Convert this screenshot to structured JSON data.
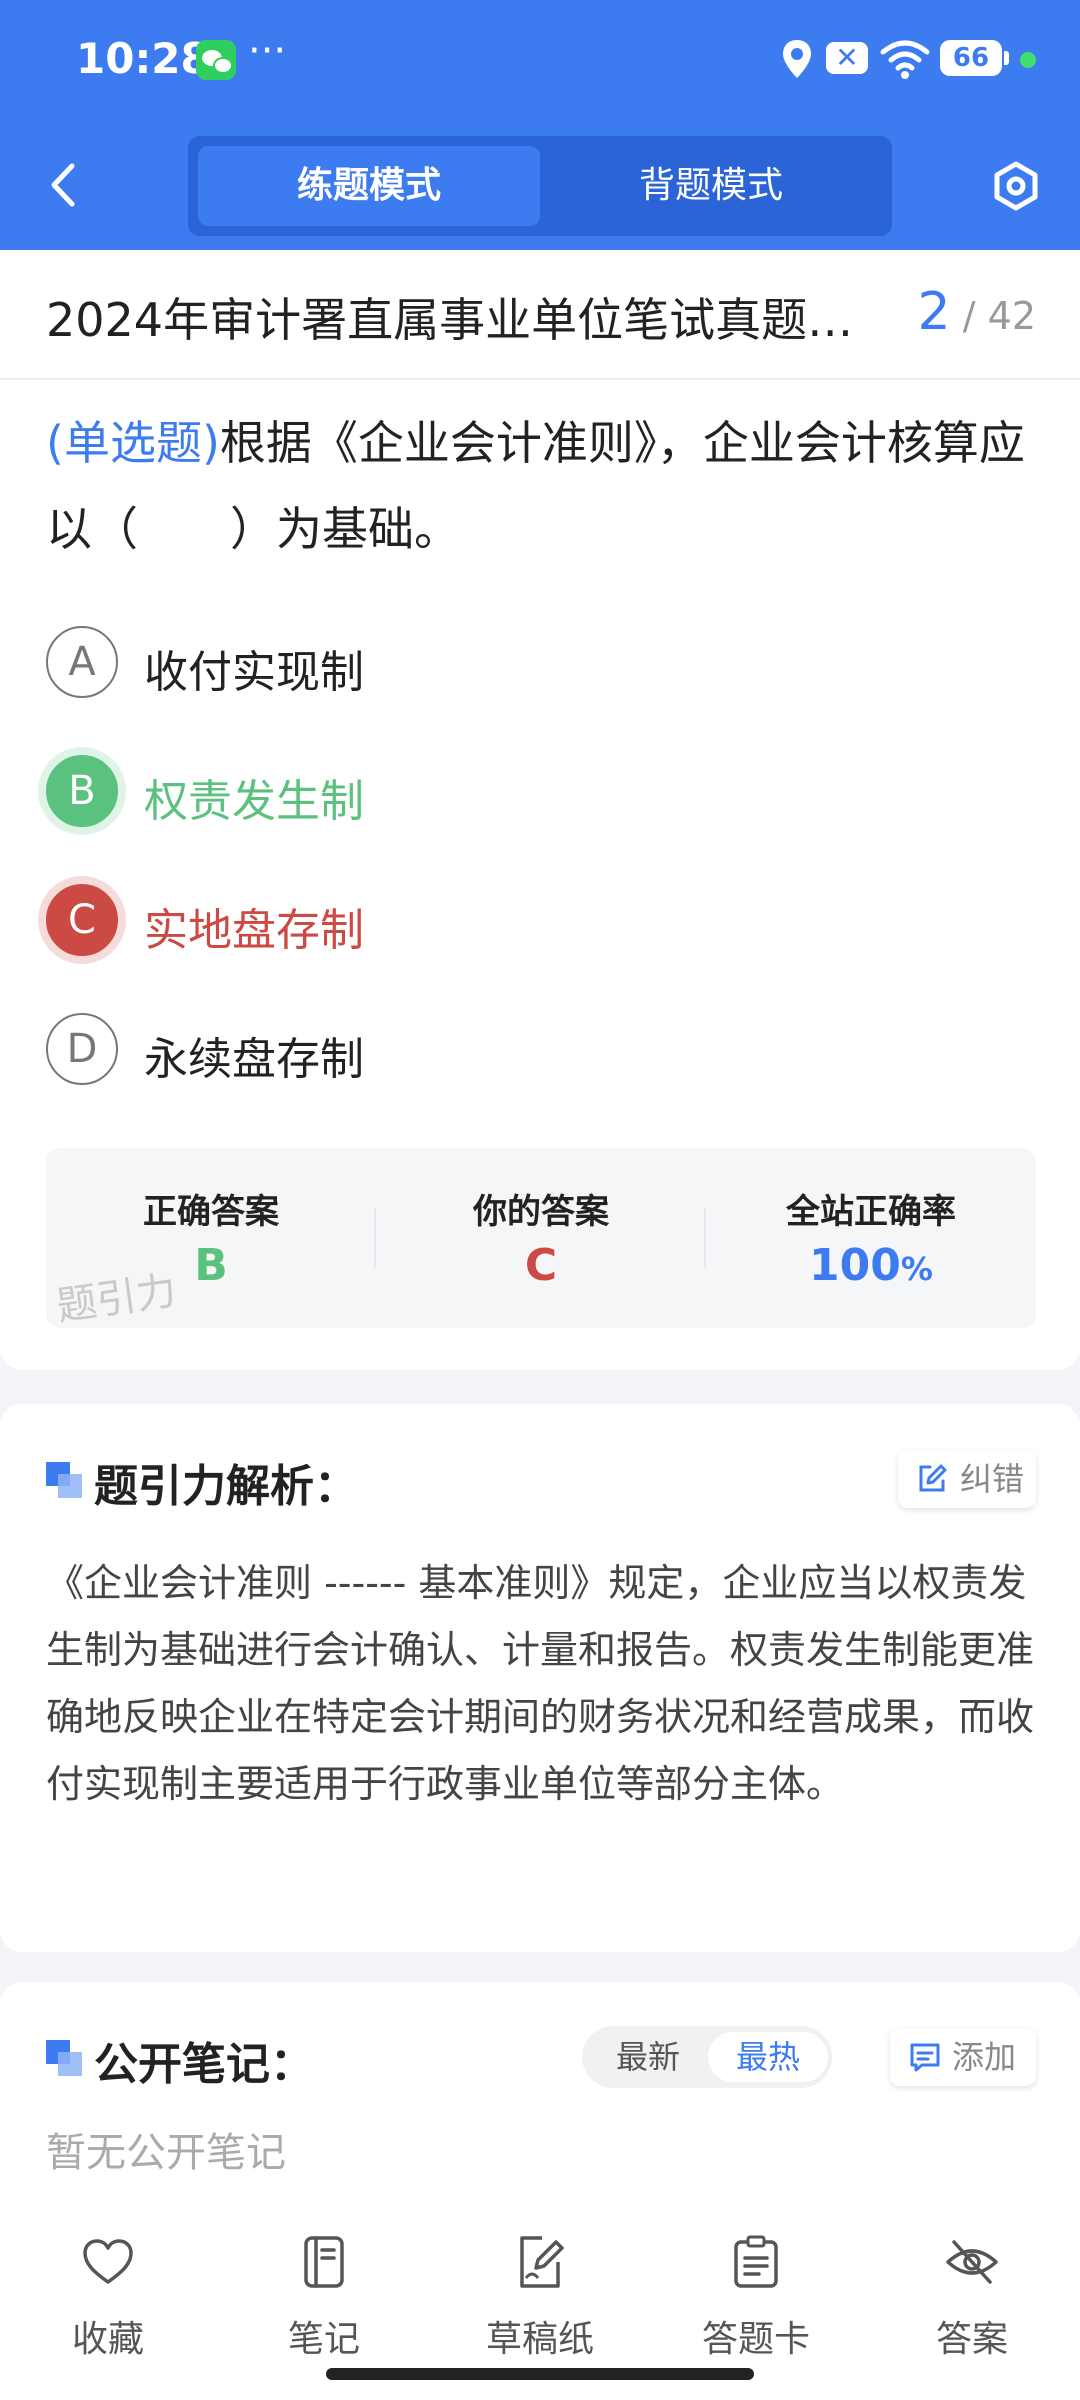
{
  "status_bar": {
    "time": "10:28",
    "dots": "···",
    "x_badge": "✕",
    "battery": "66"
  },
  "header": {
    "mode_tabs": [
      {
        "label": "练题模式",
        "active": true
      },
      {
        "label": "背题模式",
        "active": false
      }
    ]
  },
  "question": {
    "doc_title": "2024年审计署直属事业单位笔试真题…",
    "current": "2",
    "separator": "/",
    "total": "42",
    "type": "(单选题)",
    "text": "根据《企业会计准则》，企业会计核算应以（　　）为基础。",
    "options": [
      {
        "letter": "A",
        "text": "收付实现制",
        "state": "normal"
      },
      {
        "letter": "B",
        "text": "权责发生制",
        "state": "correct"
      },
      {
        "letter": "C",
        "text": "实地盘存制",
        "state": "wrong"
      },
      {
        "letter": "D",
        "text": "永续盘存制",
        "state": "normal"
      }
    ]
  },
  "result": {
    "correct_label": "正确答案",
    "correct_value": "B",
    "yours_label": "你的答案",
    "yours_value": "C",
    "rate_label": "全站正确率",
    "rate_value": "100",
    "rate_unit": "%",
    "watermark": "题引力"
  },
  "analysis": {
    "title": "题引力解析：",
    "report_label": "纠错",
    "text": "《企业会计准则 ------ 基本准则》规定，企业应当以权责发生制为基础进行会计确认、计量和报告。权责发生制能更准确地反映企业在特定会计期间的财务状况和经营成果，而收付实现制主要适用于行政事业单位等部分主体。"
  },
  "notes": {
    "title": "公开笔记：",
    "sort_options": [
      "最新",
      "最热"
    ],
    "add_label": "添加",
    "empty_text": "暂无公开笔记"
  },
  "bottom_nav": [
    {
      "label": "收藏",
      "icon": "heart-icon"
    },
    {
      "label": "笔记",
      "icon": "notebook-icon"
    },
    {
      "label": "草稿纸",
      "icon": "draft-paper-icon"
    },
    {
      "label": "答题卡",
      "icon": "answer-sheet-icon"
    },
    {
      "label": "答案",
      "icon": "eye-off-icon"
    }
  ],
  "colors": {
    "primary": "#3d7cf0",
    "correct": "#5ac17e",
    "wrong": "#cc4a44"
  }
}
